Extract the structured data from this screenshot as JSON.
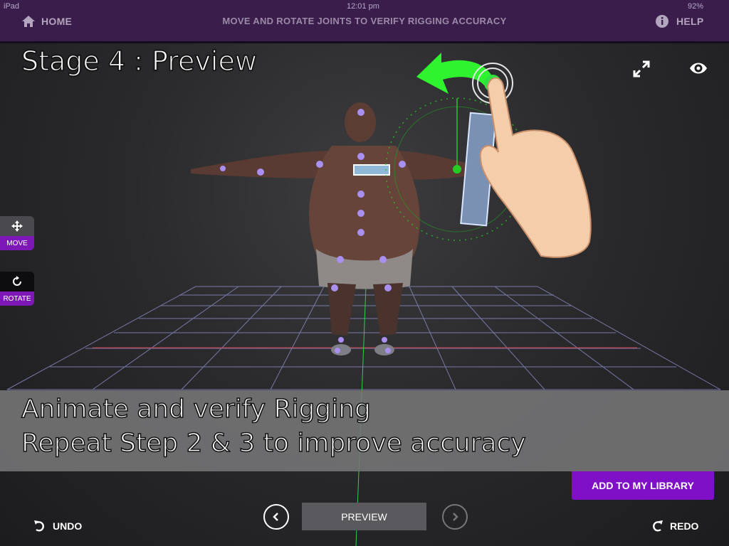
{
  "status_bar": {
    "device": "iPad",
    "time": "12:01 pm",
    "battery": "92%"
  },
  "top_bar": {
    "home_label": "HOME",
    "title": "MOVE AND ROTATE JOINTS TO VERIFY RIGGING ACCURACY",
    "help_label": "HELP"
  },
  "stage_title": "Stage 4 : Preview",
  "side_tools": {
    "move_label": "MOVE",
    "rotate_label": "ROTATE"
  },
  "caption": {
    "line1": "Animate and verify Rigging",
    "line2": "Repeat Step 2 & 3 to improve accuracy"
  },
  "actions": {
    "add_to_library_label": "ADD TO MY LIBRARY"
  },
  "bottom_bar": {
    "undo_label": "UNDO",
    "preview_label": "PREVIEW",
    "redo_label": "REDO"
  },
  "colors": {
    "accent": "#8010c8",
    "topbar": "#3a1d4a",
    "joint": "#a98ff0",
    "gizmo": "#22cc22"
  },
  "icons": [
    "home-icon",
    "info-icon",
    "expand-icon",
    "eye-icon",
    "move-arrows-icon",
    "rotate-icon",
    "undo-icon",
    "redo-icon",
    "chevron-left-icon",
    "chevron-right-icon"
  ]
}
